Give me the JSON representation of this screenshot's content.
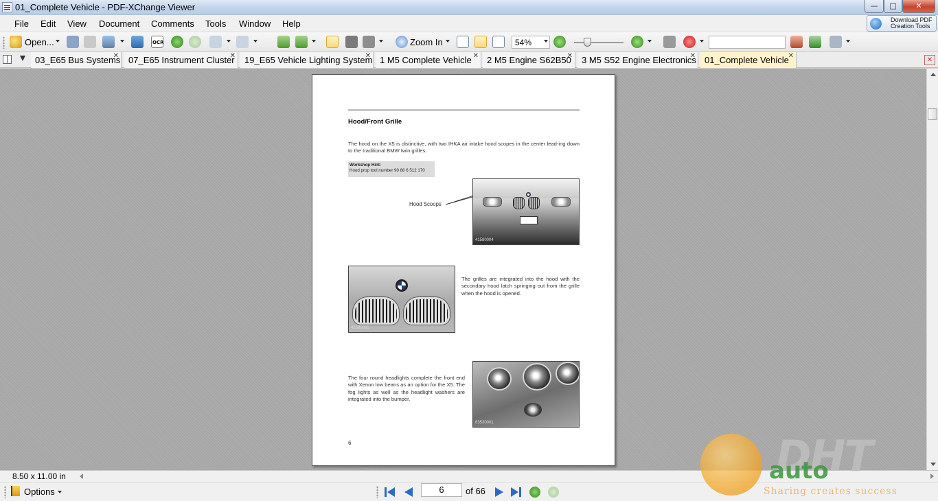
{
  "window": {
    "title": "01_Complete Vehicle - PDF-XChange Viewer"
  },
  "menu": [
    "File",
    "Edit",
    "View",
    "Document",
    "Comments",
    "Tools",
    "Window",
    "Help"
  ],
  "download_tools": {
    "line1": "Download PDF",
    "line2": "Creation Tools"
  },
  "toolbar": {
    "open_label": "Open...",
    "ocr_label": "OCR",
    "zoom_in_label": "Zoom In",
    "zoom_value": "54%"
  },
  "tabs": [
    {
      "label": "03_E65 Bus Systems",
      "active": false
    },
    {
      "label": "07_E65 Instrument Cluster",
      "active": false
    },
    {
      "label": "19_E65 Vehicle Lighting System",
      "active": false
    },
    {
      "label": "1 M5 Complete Vehicle",
      "active": false
    },
    {
      "label": "2 M5 Engine S62B50",
      "active": false
    },
    {
      "label": "3 M5 S52 Engine Electronics",
      "active": false
    },
    {
      "label": "01_Complete Vehicle",
      "active": true
    }
  ],
  "page": {
    "heading": "Hood/Front Grille",
    "intro": "The hood on the X5 is distinctive, with two IHKA air intake  hood scopes in the center lead-ing down to the traditional BMW twin grilles.",
    "hint_title": "Workshop Hint:",
    "hint_text": "Hood prop tool number 90 88 6 512 170",
    "callout": "Hood Scoops",
    "photo1_code": "41580004",
    "grilles_text": "The grilles are integrated into the hood with the secondary hood latch springing out from the grille when the hood is opened.",
    "photo2_code": "41580005",
    "headlights_text": "The four round headlights complete the front end with Xenon low beans as an option for the X5. The fog lights as well as the headlight washers are integrated into the bumper.",
    "photo3_code": "63530001",
    "page_number": "6"
  },
  "status": {
    "page_size": "8.50 x 11.00 in",
    "options_label": "Options"
  },
  "navigation": {
    "current_page": "6",
    "of_label": "of 66"
  },
  "watermark": {
    "brand": "DHT",
    "auto": "auto",
    "tagline": "Sharing creates success"
  },
  "colors": {
    "accent": "#ffd875",
    "active_tab": "#fff3cc",
    "doc_bg": "#a6a6a6",
    "close": "#c4442a"
  }
}
